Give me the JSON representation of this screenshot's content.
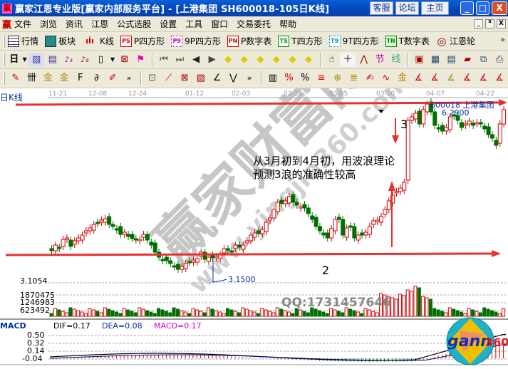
{
  "window": {
    "title": "赢家江恩专业版[赢家内部服务平台] - [上港集团   SH600018-105日K线]",
    "buttons": [
      "客服",
      "论坛",
      "主页"
    ],
    "controls": {
      "minimize": "_",
      "maximize": "□",
      "close": "X"
    }
  },
  "menubar": {
    "logo": "赢",
    "items": [
      "文件",
      "浏览",
      "资讯",
      "江恩",
      "公式选股",
      "设置",
      "工具",
      "窗口",
      "交易委托",
      "帮助"
    ],
    "mdi_controls": [
      "_",
      "ᴮ",
      "X"
    ]
  },
  "toolbar1": {
    "items": [
      {
        "icon": "quote-table-icon",
        "glyph": "▦",
        "label": "行情"
      },
      {
        "icon": "sector-grid-icon",
        "glyph": "▩",
        "label": "板块"
      },
      {
        "icon": "kline-icon",
        "glyph": "ıİı",
        "label": "K线"
      },
      {
        "icon": "ps-icon",
        "glyph": "PS",
        "label": "P四方形"
      },
      {
        "icon": "p9-icon",
        "glyph": "P9",
        "label": "9P四方形"
      },
      {
        "icon": "pn-icon",
        "glyph": "PN",
        "label": "P数字表"
      },
      {
        "icon": "ts-icon",
        "glyph": "TS",
        "label": "T四方形"
      },
      {
        "icon": "t9-icon",
        "glyph": "T9",
        "label": "9T四方形"
      },
      {
        "icon": "tn-icon",
        "glyph": "TN",
        "label": "T数字表"
      },
      {
        "icon": "gann-wheel-icon",
        "glyph": "◎",
        "label": "江恩轮"
      }
    ],
    "overflow": "»"
  },
  "toolbar2": {
    "period": "日",
    "icons": [
      "pattern-icon",
      "notes-icon",
      "wave3-icon",
      "wave9-icon",
      "candle-type-icon",
      "dropdown-icon",
      "calc-icon",
      "flag-icon",
      "first-icon",
      "last-icon",
      "prev-icon",
      "next-icon",
      "diamond-left-icon",
      "diamond-right-icon",
      "diamond-up-icon",
      "diamond-down-icon",
      "diamond-star-icon",
      "diamond-cross-icon",
      "hand-icon",
      "crosshair-icon",
      "line-tool-icon",
      "section-icon",
      "wave-line-icon",
      "calendar-icon",
      "calculator-icon",
      "report-icon",
      "save-icon",
      "network-icon",
      "printer-icon"
    ]
  },
  "toolbar3": {
    "icons": [
      "pen-icon",
      "grid-icon",
      "gold-ruler-icon",
      "gold-ruler2-icon",
      "fib-icon",
      "spiral-icon",
      "marker-icon",
      "box-icon",
      "fan-icon",
      "square-fan-icon",
      "red-fan-icon",
      "angle-icon",
      "zigzag-icon",
      "bar-icon",
      "percent-red-icon",
      "percent-icon",
      "percent-lines-icon",
      "gold-circle-icon",
      "gold-lines-icon",
      "brush-icon",
      "sine-icon",
      "gold-icon",
      "j-angle-icon",
      "f-angle-icon",
      "gold-angle-icon",
      "lian-angle-icon",
      "ying-angle-icon",
      "si-angle-icon"
    ],
    "overflow": "»"
  },
  "chart": {
    "panel_label": "日K线",
    "dates": [
      "11-21",
      "12-08",
      "12-24",
      "01-12",
      "02-03",
      "02-18",
      "03-05",
      "03-20",
      "04-07",
      "04-22"
    ],
    "stock_label": "600018 上港集团",
    "high_price": "6.2900",
    "low_price": "3.1500",
    "axis_low": "3.1054",
    "annotation_line1": "从3月初到4月初，用波浪理论",
    "annotation_line2": "预测3浪的准确性较高",
    "wave2_label": "2",
    "wave3_label": "3",
    "watermark_cn": "赢家财富网",
    "watermark_url": "www.yingjia360.com",
    "watermark_qq": "QQ:1731457646",
    "colors": {
      "up": "#d00000",
      "down": "#007000",
      "arrow": "#e83030"
    }
  },
  "volume": {
    "ticks": [
      "1870475",
      "1246983",
      "623492"
    ]
  },
  "macd": {
    "label": "MACD",
    "dif": "DIF=0.17",
    "dea": "DEA=0.08",
    "macd": "MACD=0.17",
    "ticks": [
      "0.50",
      "0.32",
      "0.14",
      "-0.04"
    ]
  },
  "logo": {
    "text": "gann",
    "num": "360"
  }
}
